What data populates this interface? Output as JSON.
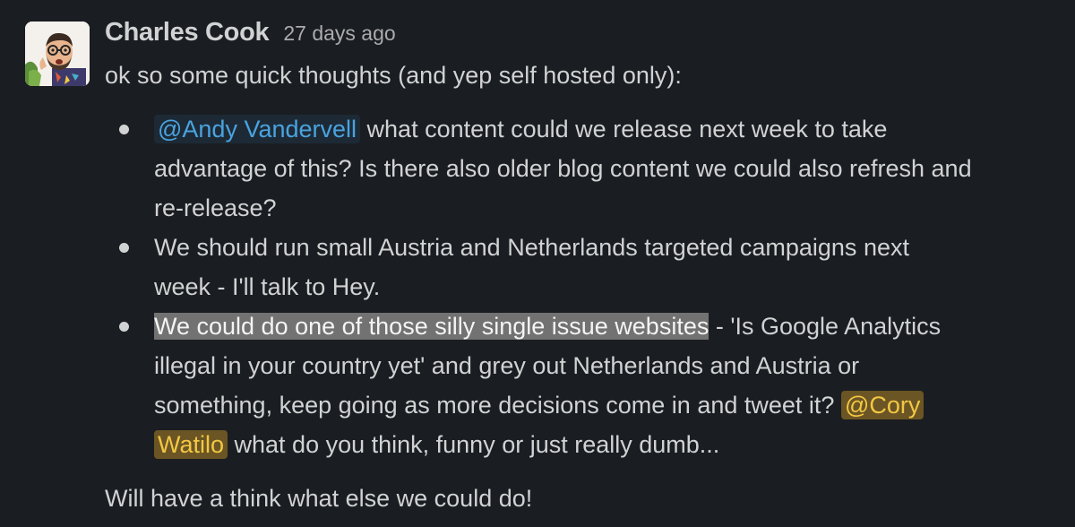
{
  "message": {
    "author": "Charles Cook",
    "timestamp": "27 days ago",
    "intro": "ok so some quick thoughts (and yep self hosted only):",
    "bullets": [
      {
        "mention": "@Andy Vandervell",
        "line1_rest": " what content could we release next week to take",
        "line2": "advantage of this? Is there also older blog content we could also refresh and",
        "line3": "re-release?"
      },
      {
        "line1": "We should run small Austria and Netherlands targeted campaigns next",
        "line2": "week - I'll talk to Hey."
      },
      {
        "highlight": "We could do one of those silly single issue websites",
        "line1_rest": " - 'Is Google Analytics",
        "line2": "illegal in your country yet' and grey out Netherlands and Austria or",
        "line3_pre": "something, keep going as more decisions come in and tweet it? ",
        "mention_part1": "@Cory",
        "mention_part2": "Watilo",
        "line4_rest": " what do you think, funny or just really dumb..."
      }
    ],
    "outro": "Will have a think what else we could do!"
  },
  "avatar_icon": "user-avatar-photo",
  "colors": {
    "background": "#1a1d21",
    "text": "#d1d2d3",
    "timestamp": "#ababad",
    "mention": "#4aa3df",
    "self_mention": "#f2c744",
    "self_mention_bg": "#6b5524",
    "highlight_bg": "#727272"
  }
}
